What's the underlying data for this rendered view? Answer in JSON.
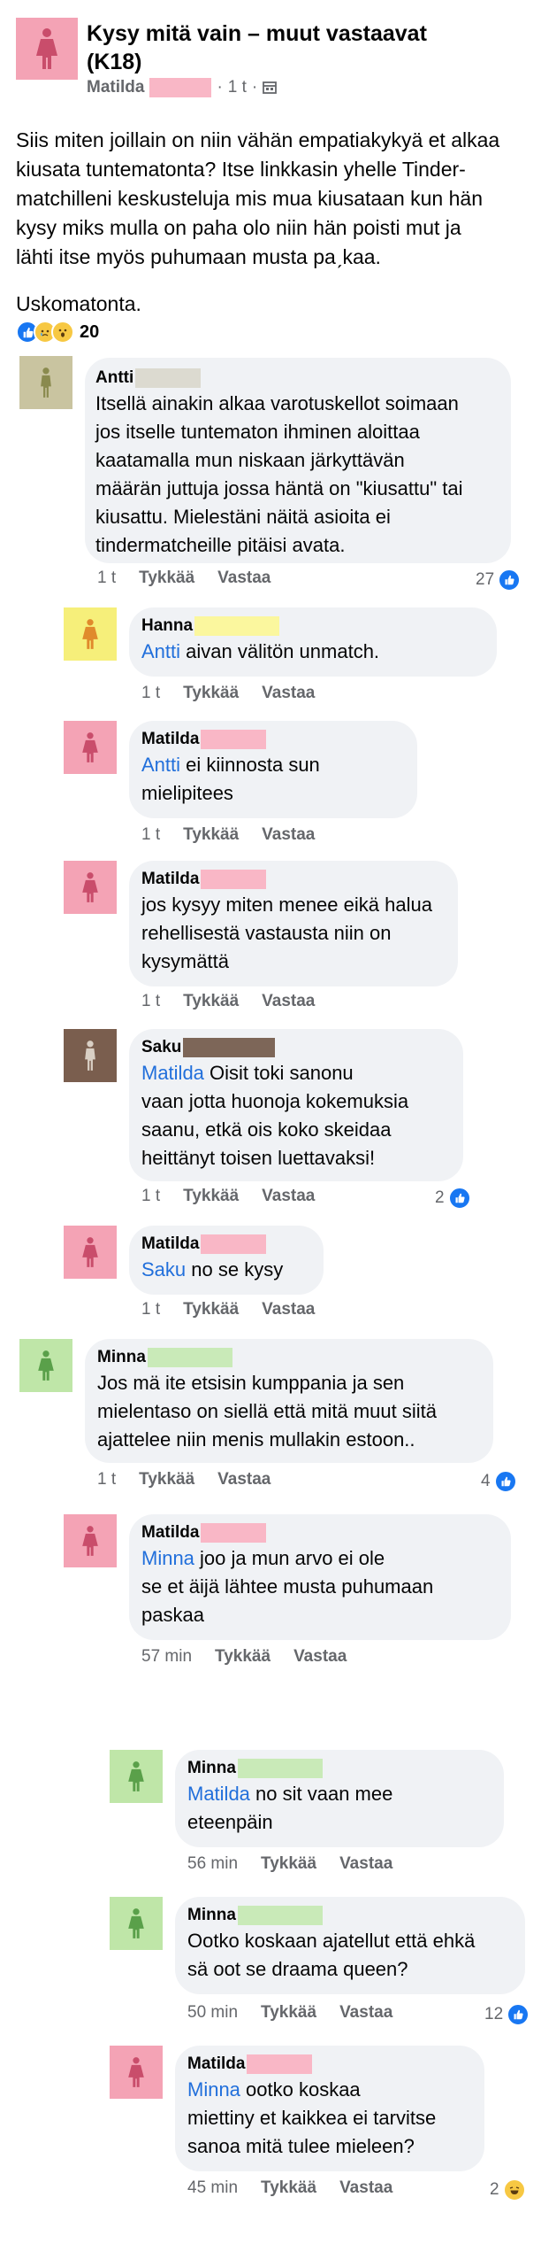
{
  "post": {
    "group_title_line1": "Kysy mitä vain – muut vastaavat",
    "group_title_line2": "(K18)",
    "author": "Matilda",
    "time": "1 t",
    "body_line1": "Siis miten joillain on niin vähän empatiakykyä et alkaa",
    "body_line2": "kiusata tuntematonta? Itse linkkasin yhelle Tinder-",
    "body_line3": "matchilleni keskusteluja mis mua kiusataan kun hän",
    "body_line4": "kysy miks mulla on paha olo niin hän poisti mut ja",
    "body_line5": "lähti itse myös puhumaan musta paˏkaa.",
    "body_line6": "Uskomatonta.",
    "reaction_count": "20"
  },
  "actions": {
    "like": "Tykkää",
    "reply": "Vastaa"
  },
  "colors": {
    "pink": "#f4a3b5",
    "pink_dark": "#c94d6b",
    "olive": "#c9c4a0",
    "olive_dark": "#8a8a4e",
    "yellow": "#f6ef7a",
    "yellow_dark": "#e08a2c",
    "brown": "#7a5e4e",
    "brown_dark": "#d9cfc4",
    "green": "#bfe6a8",
    "green_dark": "#5aa04a",
    "link": "#216fdb"
  },
  "comments": [
    {
      "author": "Antti",
      "mention": "",
      "lines": [
        "Itsellä ainakin alkaa varotuskellot soimaan",
        "jos itselle tuntematon ihminen aloittaa",
        "kaatamalla mun niskaan järkyttävän",
        "määrän juttuja jossa häntä on \"kiusattu\" tai",
        "kiusattu. Mielestäni näitä asioita ei",
        "tindermatcheille pitäisi avata."
      ],
      "time": "1 t",
      "reactions": "27"
    },
    {
      "author": "Hanna",
      "mention": "Antti",
      "lines": [
        " aivan välitön unmatch."
      ],
      "time": "1 t",
      "reactions": ""
    },
    {
      "author": "Matilda",
      "mention": "Antti",
      "lines": [
        " ei kiinnosta sun",
        "mielipitees"
      ],
      "time": "1 t",
      "reactions": ""
    },
    {
      "author": "Matilda",
      "mention": "",
      "lines": [
        "jos kysyy miten menee eikä halua",
        "rehellisestä vastausta niin on",
        "kysymättä"
      ],
      "time": "1 t",
      "reactions": ""
    },
    {
      "author": "Saku",
      "mention": "Matilda",
      "lines": [
        " Oisit toki sanonu",
        "vaan jotta huonoja kokemuksia",
        "saanu, etkä ois koko skeidaa",
        "heittänyt toisen luettavaksi!"
      ],
      "time": "1 t",
      "reactions": "2"
    },
    {
      "author": "Matilda",
      "mention": "Saku",
      "lines": [
        " no se kysy"
      ],
      "time": "1 t",
      "reactions": ""
    },
    {
      "author": "Minna",
      "mention": "",
      "lines": [
        "Jos mä ite etsisin kumppania ja sen",
        "mielentaso on siellä että mitä muut siitä",
        "ajattelee niin menis mullakin estoon.."
      ],
      "time": "1 t",
      "reactions": "4"
    },
    {
      "author": "Matilda",
      "mention": "Minna",
      "lines": [
        " joo ja mun arvo ei ole",
        "se et äijä lähtee musta puhumaan",
        "paskaa"
      ],
      "time": "57 min",
      "reactions": ""
    },
    {
      "author": "Minna",
      "mention": "Matilda",
      "lines": [
        " no sit vaan mee",
        "eteenpäin"
      ],
      "time": "56 min",
      "reactions": ""
    },
    {
      "author": "Minna",
      "mention": "",
      "lines": [
        "Ootko koskaan ajatellut että ehkä",
        "sä oot se draama queen?"
      ],
      "time": "50 min",
      "reactions": "12"
    },
    {
      "author": "Matilda",
      "mention": "Minna",
      "lines": [
        " ootko koskaa",
        "miettiny et kaikkea ei tarvitse",
        "sanoa mitä tulee mieleen?"
      ],
      "time": "45 min",
      "reactions": "2"
    }
  ]
}
